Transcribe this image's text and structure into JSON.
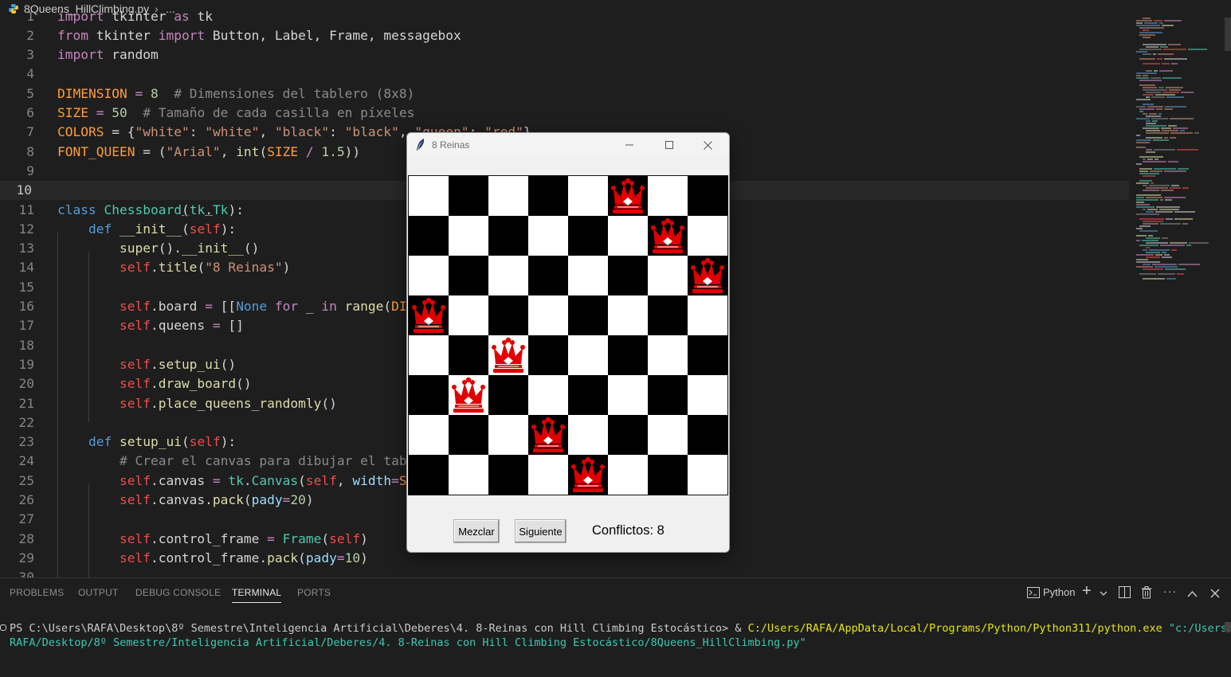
{
  "breadcrumb": {
    "file": "8Queens_HillClimbing.py",
    "separator": "›",
    "more": "..."
  },
  "editor": {
    "current_line": 10,
    "colors": {
      "keyword": "#c586c0",
      "control": "#569cd6",
      "constant": "#ff9d3b",
      "string": "#ce9178",
      "comment": "#8a8a8a",
      "function": "#dcdcaa",
      "class": "#4ec9b0",
      "self": "#f14c4c",
      "param": "#9cdcfe",
      "number": "#b5cea8"
    },
    "lines": [
      {
        "n": "1",
        "tokens": [
          [
            "import",
            "kw"
          ],
          [
            " tkinter ",
            ""
          ],
          [
            "as",
            "kw"
          ],
          [
            " tk",
            ""
          ]
        ]
      },
      {
        "n": "2",
        "tokens": [
          [
            "from",
            "kw"
          ],
          [
            " tkinter ",
            ""
          ],
          [
            "import",
            "kw"
          ],
          [
            " Button, Label, Frame, messagebox",
            ""
          ]
        ]
      },
      {
        "n": "3",
        "tokens": [
          [
            "import",
            "kw"
          ],
          [
            " random",
            ""
          ]
        ]
      },
      {
        "n": "4",
        "tokens": []
      },
      {
        "n": "5",
        "tokens": [
          [
            "DIMENSION",
            "const"
          ],
          [
            " = ",
            "op"
          ],
          [
            "8",
            "num"
          ],
          [
            "  # Dimensiones del tablero (8x8)",
            "cmt"
          ]
        ]
      },
      {
        "n": "6",
        "tokens": [
          [
            "SIZE",
            "const"
          ],
          [
            " = ",
            "op"
          ],
          [
            "50",
            "num"
          ],
          [
            "  # Tamaño de cada casilla en píxeles",
            "cmt"
          ]
        ]
      },
      {
        "n": "7",
        "tokens": [
          [
            "COLORS",
            "const"
          ],
          [
            " = {",
            ""
          ],
          [
            "\"white\"",
            "str"
          ],
          [
            ": ",
            ""
          ],
          [
            "\"white\"",
            "str"
          ],
          [
            ", ",
            ""
          ],
          [
            "\"black\"",
            "str"
          ],
          [
            ": ",
            ""
          ],
          [
            "\"black\"",
            "str"
          ],
          [
            ", ",
            ""
          ],
          [
            "\"queen\"",
            "str"
          ],
          [
            ": ",
            ""
          ],
          [
            "\"red\"",
            "str"
          ],
          [
            "}",
            ""
          ]
        ]
      },
      {
        "n": "8",
        "tokens": [
          [
            "FONT_QUEEN",
            "const"
          ],
          [
            " = (",
            ""
          ],
          [
            "\"Arial\"",
            "str"
          ],
          [
            ", ",
            ""
          ],
          [
            "int",
            "fn"
          ],
          [
            "(",
            ""
          ],
          [
            "SIZE",
            "const"
          ],
          [
            " / ",
            "op"
          ],
          [
            "1.5",
            "num"
          ],
          [
            "))",
            ""
          ]
        ]
      },
      {
        "n": "9",
        "tokens": []
      },
      {
        "n": "10",
        "tokens": []
      },
      {
        "n": "11",
        "tokens": [
          [
            "class",
            "ctl"
          ],
          [
            " ",
            ""
          ],
          [
            "Chessboard",
            "cls"
          ],
          [
            "(",
            ""
          ],
          [
            "tk",
            "cls"
          ],
          [
            ".",
            ""
          ],
          [
            "Tk",
            "cls"
          ],
          [
            "):",
            ""
          ]
        ]
      },
      {
        "n": "12",
        "tokens": [
          [
            "    ",
            ""
          ],
          [
            "def",
            "ctl"
          ],
          [
            " ",
            ""
          ],
          [
            "__init__",
            "fn"
          ],
          [
            "(",
            ""
          ],
          [
            "self",
            "self"
          ],
          [
            "):",
            ""
          ]
        ]
      },
      {
        "n": "13",
        "tokens": [
          [
            "        ",
            ""
          ],
          [
            "super",
            "fn"
          ],
          [
            "().",
            ""
          ],
          [
            "__init__",
            "fn"
          ],
          [
            "()",
            ""
          ]
        ]
      },
      {
        "n": "14",
        "tokens": [
          [
            "        ",
            ""
          ],
          [
            "self",
            "self"
          ],
          [
            ".",
            ""
          ],
          [
            "title",
            "fn"
          ],
          [
            "(",
            ""
          ],
          [
            "\"8 Reinas\"",
            "str"
          ],
          [
            ")",
            ""
          ]
        ]
      },
      {
        "n": "15",
        "tokens": []
      },
      {
        "n": "16",
        "tokens": [
          [
            "        ",
            ""
          ],
          [
            "self",
            "self"
          ],
          [
            ".board ",
            ""
          ],
          [
            "=",
            "op"
          ],
          [
            " [[",
            ""
          ],
          [
            "None",
            "ctl"
          ],
          [
            " ",
            ""
          ],
          [
            "for",
            "kw"
          ],
          [
            " _ ",
            ""
          ],
          [
            "in",
            "kw"
          ],
          [
            " ",
            ""
          ],
          [
            "range",
            "fn"
          ],
          [
            "(",
            ""
          ],
          [
            "DIMENSION",
            "const"
          ],
          [
            ") ",
            ""
          ],
          [
            "for",
            "kw"
          ],
          [
            " _ ",
            ""
          ],
          [
            "in",
            "kw"
          ],
          [
            " ",
            ""
          ],
          [
            "range",
            "fn"
          ],
          [
            "(",
            ""
          ],
          [
            "DIMENSION",
            "const"
          ],
          [
            ")]",
            ""
          ]
        ]
      },
      {
        "n": "17",
        "tokens": [
          [
            "        ",
            ""
          ],
          [
            "self",
            "self"
          ],
          [
            ".queens ",
            ""
          ],
          [
            "=",
            "op"
          ],
          [
            " []",
            ""
          ]
        ]
      },
      {
        "n": "18",
        "tokens": []
      },
      {
        "n": "19",
        "tokens": [
          [
            "        ",
            ""
          ],
          [
            "self",
            "self"
          ],
          [
            ".",
            ""
          ],
          [
            "setup_ui",
            "fn"
          ],
          [
            "()",
            ""
          ]
        ]
      },
      {
        "n": "20",
        "tokens": [
          [
            "        ",
            ""
          ],
          [
            "self",
            "self"
          ],
          [
            ".",
            ""
          ],
          [
            "draw_board",
            "fn"
          ],
          [
            "()",
            ""
          ]
        ]
      },
      {
        "n": "21",
        "tokens": [
          [
            "        ",
            ""
          ],
          [
            "self",
            "self"
          ],
          [
            ".",
            ""
          ],
          [
            "place_queens_randomly",
            "fn"
          ],
          [
            "()",
            ""
          ]
        ]
      },
      {
        "n": "22",
        "tokens": []
      },
      {
        "n": "23",
        "tokens": [
          [
            "    ",
            ""
          ],
          [
            "def",
            "ctl"
          ],
          [
            " ",
            ""
          ],
          [
            "setup_ui",
            "fn"
          ],
          [
            "(",
            ""
          ],
          [
            "self",
            "self"
          ],
          [
            "):",
            ""
          ]
        ]
      },
      {
        "n": "24",
        "tokens": [
          [
            "        ",
            ""
          ],
          [
            "# Crear el canvas para dibujar el tablero",
            "cmt"
          ]
        ]
      },
      {
        "n": "25",
        "tokens": [
          [
            "        ",
            ""
          ],
          [
            "self",
            "self"
          ],
          [
            ".canvas ",
            ""
          ],
          [
            "=",
            "op"
          ],
          [
            " ",
            ""
          ],
          [
            "tk",
            "cls"
          ],
          [
            ".",
            ""
          ],
          [
            "Canvas",
            "cls"
          ],
          [
            "(",
            ""
          ],
          [
            "self",
            "self"
          ],
          [
            ", ",
            ""
          ],
          [
            "width",
            "param"
          ],
          [
            "=",
            "op"
          ],
          [
            "SIZE",
            "const"
          ],
          [
            " * ",
            ""
          ],
          [
            "DIMENSION",
            "const"
          ],
          [
            ")",
            ""
          ]
        ]
      },
      {
        "n": "26",
        "tokens": [
          [
            "        ",
            ""
          ],
          [
            "self",
            "self"
          ],
          [
            ".canvas.",
            ""
          ],
          [
            "pack",
            "fn"
          ],
          [
            "(",
            ""
          ],
          [
            "pady",
            "param"
          ],
          [
            "=",
            "op"
          ],
          [
            "20",
            "num"
          ],
          [
            ")",
            ""
          ]
        ]
      },
      {
        "n": "27",
        "tokens": []
      },
      {
        "n": "28",
        "tokens": [
          [
            "        ",
            ""
          ],
          [
            "self",
            "self"
          ],
          [
            ".control_frame ",
            ""
          ],
          [
            "=",
            "op"
          ],
          [
            " ",
            ""
          ],
          [
            "Frame",
            "cls"
          ],
          [
            "(",
            ""
          ],
          [
            "self",
            "self"
          ],
          [
            ")",
            ""
          ]
        ]
      },
      {
        "n": "29",
        "tokens": [
          [
            "        ",
            ""
          ],
          [
            "self",
            "self"
          ],
          [
            ".control_frame.",
            ""
          ],
          [
            "pack",
            "fn"
          ],
          [
            "(",
            ""
          ],
          [
            "pady",
            "param"
          ],
          [
            "=",
            "op"
          ],
          [
            "10",
            "num"
          ],
          [
            ")",
            ""
          ]
        ]
      },
      {
        "n": "30",
        "tokens": []
      }
    ]
  },
  "panel": {
    "tabs": [
      "PROBLEMS",
      "OUTPUT",
      "DEBUG CONSOLE",
      "TERMINAL",
      "PORTS"
    ],
    "active_tab": "TERMINAL",
    "terminal_profile": "Python",
    "terminal": {
      "prompt": "PS C:\\Users\\RAFA\\Desktop\\8º Semestre\\Inteligencia Artificial\\Deberes\\4. 8-Reinas con Hill Climbing Estocástico> ",
      "operator": "& ",
      "exe": "C:/Users/RAFA/AppData/Local/Programs/Python/Python311/python.exe",
      "arg_start": " \"c:/Users/",
      "arg_rest": "RAFA/Desktop/8º Semestre/Inteligencia Artificial/Deberes/4. 8-Reinas con Hill Climbing Estocástico/8Queens_HillClimbing.py\""
    }
  },
  "tk_window": {
    "title": "8 Reinas",
    "queens": [
      3,
      5,
      4,
      6,
      7,
      0,
      1,
      2
    ],
    "buttons": {
      "shuffle": "Mezclar",
      "next": "Siguiente"
    },
    "conflicts_label": "Conflictos: 8",
    "colors": {
      "white": "#ffffff",
      "black": "#000000",
      "queen": "#e00000"
    }
  }
}
